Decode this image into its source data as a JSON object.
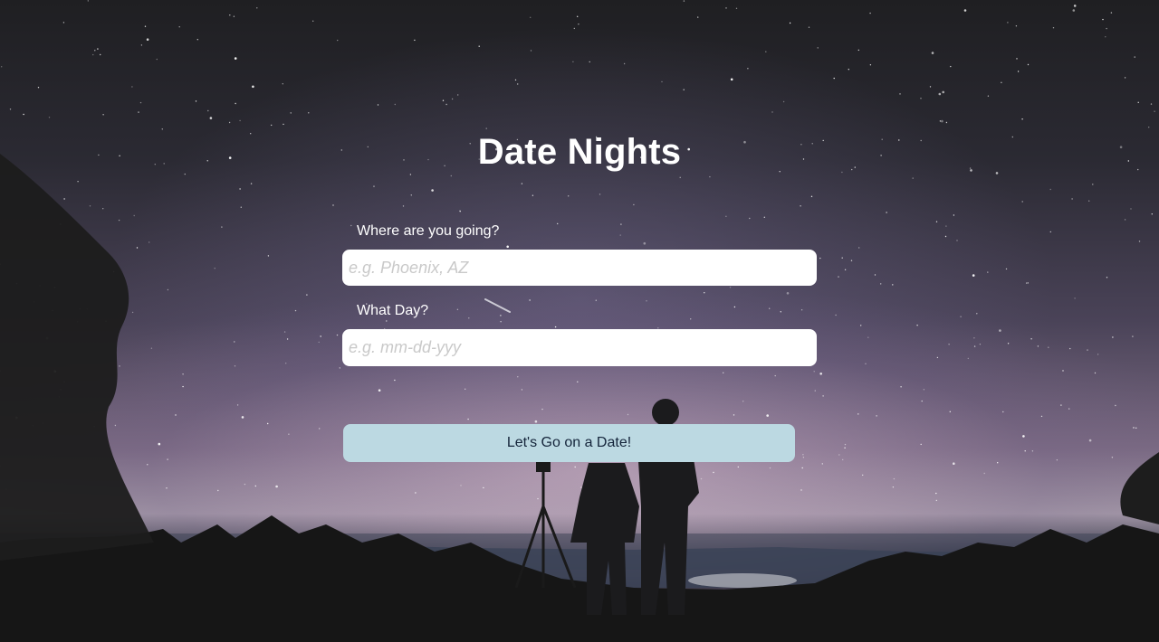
{
  "app": {
    "title": "Date Nights"
  },
  "form": {
    "destination": {
      "label": "Where are you going?",
      "placeholder": "e.g. Phoenix, AZ",
      "value": ""
    },
    "date": {
      "label": "What Day?",
      "placeholder": "e.g. mm-dd-yyy",
      "value": ""
    },
    "submit_label": "Let's Go on a Date!"
  },
  "colors": {
    "button_background": "#bcd9e2",
    "button_text": "#14243a",
    "title_text": "#ffffff",
    "input_background": "#ffffff",
    "placeholder_text": "#c9c9c9"
  }
}
